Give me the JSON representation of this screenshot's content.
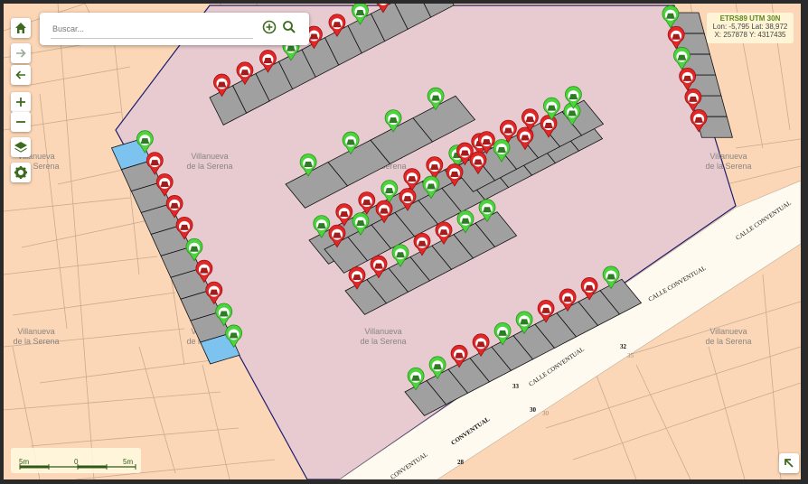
{
  "search": {
    "placeholder": "Buscar..."
  },
  "toolbar": {
    "home_icon": "home-icon",
    "forward_icon": "arrow-right-icon",
    "back_icon": "arrow-left-icon",
    "zoom_in_icon": "plus-icon",
    "zoom_out_icon": "minus-icon",
    "layers_icon": "layers-icon",
    "settings_icon": "gear-icon"
  },
  "coords": {
    "title": "ETRS89 UTM 30N",
    "lonlat": "Lon: -5,795 Lat: 38,972",
    "xy": "X: 257878 Y: 4317435"
  },
  "scale": {
    "left": "5m",
    "mid": "0",
    "right": "5m"
  },
  "map_labels": {
    "town": [
      "Villanueva",
      "de la Serena"
    ],
    "streets": [
      "CALLE CONVENTUAL",
      "CALLE CONVENTUAL",
      "CALLE CONVENTUAL",
      "CONVENTUAL",
      "CONVENTUAL"
    ],
    "numbers": [
      "32",
      "33",
      "30",
      "28",
      "30",
      "35"
    ]
  },
  "legend_colors": {
    "parcel": "#fbd7b7",
    "lot": "#e8c9cf",
    "stall": "#a0a0a0",
    "accessible": "#7cc3ef",
    "street": "#fffaef",
    "free": "#4cd43c",
    "occupied": "#e12727"
  },
  "parking": {
    "status_names": [
      "free",
      "occupied"
    ],
    "row_a": [
      "occupied",
      "occupied",
      "occupied",
      "free",
      "occupied",
      "occupied",
      "free",
      "occupied",
      "occupied",
      "free"
    ],
    "row_b": [
      "free",
      "free",
      "free",
      "free"
    ],
    "row_c": [
      "free",
      "occupied",
      "occupied",
      "free",
      "occupied",
      "occupied",
      "free",
      "occupied"
    ],
    "row_d": [
      "occupied",
      "free",
      "occupied",
      "occupied",
      "free",
      "occupied",
      "occupied",
      "free",
      "occupied",
      "occupied",
      "free"
    ],
    "row_e": [
      "occupied",
      "occupied",
      "free",
      "occupied",
      "occupied",
      "free",
      "free"
    ],
    "row_f": [
      "occupied",
      "occupied",
      "occupied",
      "occupied",
      "free",
      "free"
    ],
    "row_g": [
      "free",
      "free",
      "occupied",
      "occupied",
      "free",
      "free",
      "occupied",
      "occupied",
      "occupied",
      "free"
    ],
    "row_h": [
      "free",
      "occupied",
      "occupied",
      "occupied",
      "occupied",
      "free",
      "occupied",
      "occupied",
      "free",
      "free"
    ],
    "row_r": [
      "free",
      "occupied",
      "free",
      "occupied",
      "occupied",
      "occupied"
    ]
  }
}
